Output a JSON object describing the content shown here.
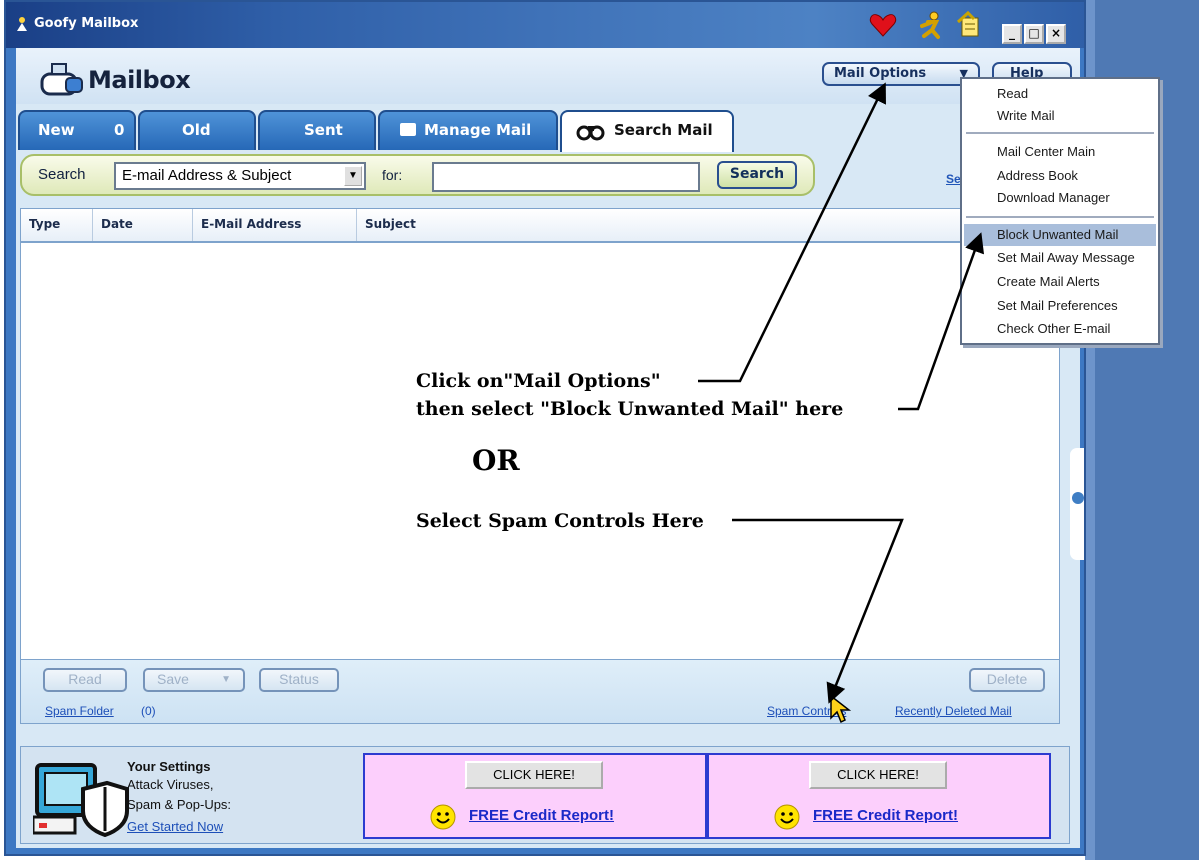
{
  "window": {
    "title": "Goofy Mailbox",
    "controls": [
      "_",
      "□",
      "×"
    ]
  },
  "header": {
    "title": "Mailbox",
    "mail_options_label": "Mail Options",
    "help_label": "Help"
  },
  "tabs": [
    {
      "label": "New",
      "count": "0"
    },
    {
      "label": "Old"
    },
    {
      "label": "Sent"
    },
    {
      "label": "Manage Mail"
    },
    {
      "label": "Search Mail"
    }
  ],
  "search": {
    "label": "Search",
    "field_value": "E-mail Address & Subject",
    "for_label": "for:",
    "input_value": "",
    "button_label": "Search",
    "side_link": "Se"
  },
  "columns": [
    "Type",
    "Date",
    "E-Mail Address",
    "Subject"
  ],
  "actions": {
    "read": "Read",
    "save": "Save",
    "status": "Status",
    "delete": "Delete",
    "spam_folder": "Spam Folder",
    "spam_folder_count": "(0)",
    "spam_controls": "Spam Controls",
    "recently_deleted": "Recently Deleted Mail"
  },
  "mail_options_menu": {
    "group1": [
      "Read",
      "Write Mail"
    ],
    "group2": [
      "Mail Center Main",
      "Address Book",
      "Download Manager"
    ],
    "group3": [
      "Block Unwanted Mail",
      "Set Mail Away Message",
      "Create Mail Alerts",
      "Set Mail Preferences",
      "Check Other E-mail"
    ],
    "highlighted": "Block Unwanted Mail"
  },
  "settings": {
    "title": "Your Settings",
    "line1": "Attack Viruses,",
    "line2": "Spam & Pop-Ups:",
    "link": "Get Started Now"
  },
  "promos": [
    {
      "button": "CLICK HERE!",
      "link": "FREE Credit Report!"
    },
    {
      "button": "CLICK HERE!",
      "link": "FREE Credit Report!"
    }
  ],
  "annotations": {
    "line1": "Click on\"Mail Options\"",
    "line2": "then select \"Block Unwanted Mail\" here",
    "or": "OR",
    "line3": "Select Spam Controls Here"
  },
  "colors": {
    "window_frame": "#3d78c3",
    "tab_blue": "#2668b7",
    "promo_bg": "#fccffc",
    "link_blue": "#1d4fb8"
  }
}
